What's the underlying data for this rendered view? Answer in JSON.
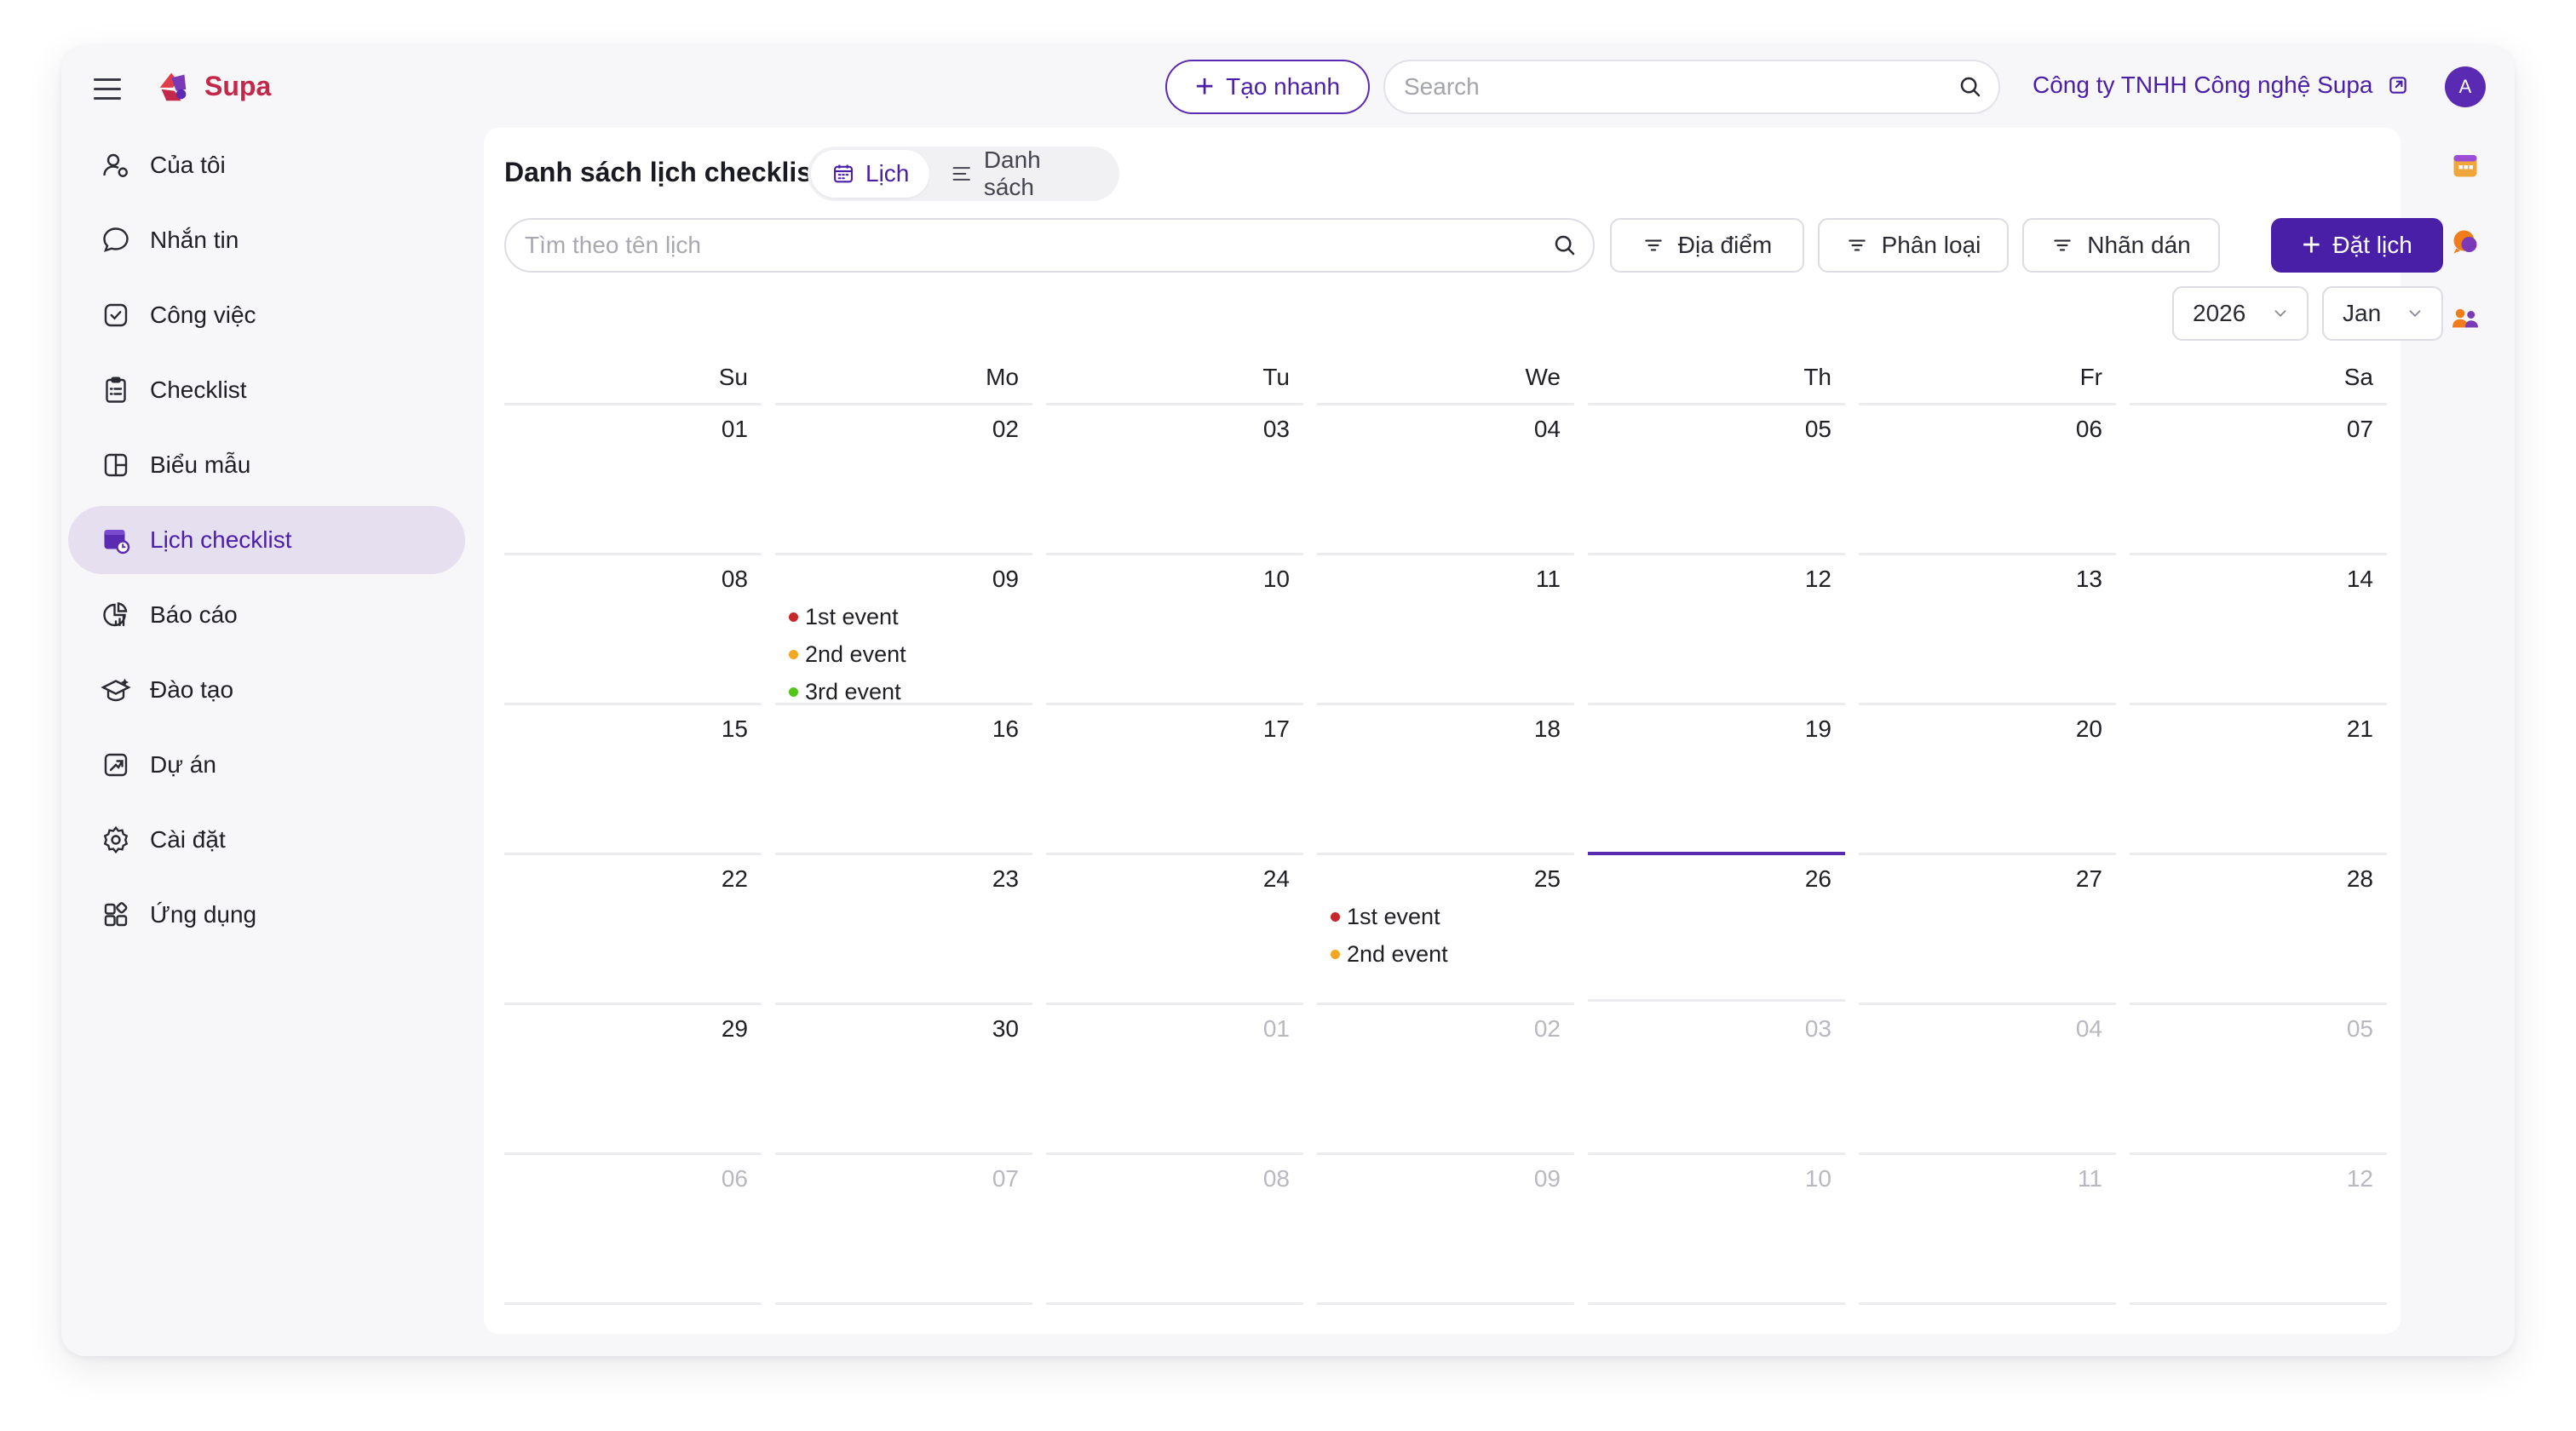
{
  "header": {
    "logo_text": "Supa",
    "quick_create_label": "Tạo nhanh",
    "search_placeholder": "Search",
    "company_name": "Công ty TNHH Công nghệ Supa",
    "avatar_initial": "A"
  },
  "sidebar": {
    "items": [
      {
        "label": "Của tôi",
        "icon": "user-profile-icon"
      },
      {
        "label": "Nhắn tin",
        "icon": "chat-bubble-icon"
      },
      {
        "label": "Công việc",
        "icon": "task-check-icon"
      },
      {
        "label": "Checklist",
        "icon": "clipboard-list-icon"
      },
      {
        "label": "Biểu mẫu",
        "icon": "form-layout-icon"
      },
      {
        "label": "Lịch checklist",
        "icon": "calendar-checklist-icon",
        "active": true
      },
      {
        "label": "Báo cáo",
        "icon": "report-chart-icon"
      },
      {
        "label": "Đào tạo",
        "icon": "graduation-cap-icon"
      },
      {
        "label": "Dự án",
        "icon": "project-icon"
      },
      {
        "label": "Cài đặt",
        "icon": "gear-icon"
      },
      {
        "label": "Ứng dụng",
        "icon": "apps-grid-icon"
      }
    ]
  },
  "main": {
    "title": "Danh sách lịch checklist",
    "view_calendar_label": "Lịch",
    "view_list_label": "Danh sách",
    "search_placeholder": "Tìm theo tên lịch",
    "filter_location": "Địa điểm",
    "filter_category": "Phân loại",
    "filter_tag": "Nhãn dán",
    "book_label": "Đặt lịch",
    "year_value": "2026",
    "month_value": "Jan"
  },
  "calendar": {
    "weekdays": [
      "Su",
      "Mo",
      "Tu",
      "We",
      "Th",
      "Fr",
      "Sa"
    ],
    "days": [
      {
        "num": "01"
      },
      {
        "num": "02"
      },
      {
        "num": "03"
      },
      {
        "num": "04"
      },
      {
        "num": "05"
      },
      {
        "num": "06"
      },
      {
        "num": "07"
      },
      {
        "num": "08"
      },
      {
        "num": "09",
        "events": [
          {
            "label": "1st event",
            "color": "#c62828"
          },
          {
            "label": "2nd event",
            "color": "#f5a623"
          },
          {
            "label": "3rd event",
            "color": "#52c41a"
          }
        ]
      },
      {
        "num": "10"
      },
      {
        "num": "11"
      },
      {
        "num": "12"
      },
      {
        "num": "13"
      },
      {
        "num": "14"
      },
      {
        "num": "15"
      },
      {
        "num": "16"
      },
      {
        "num": "17"
      },
      {
        "num": "18"
      },
      {
        "num": "19"
      },
      {
        "num": "20"
      },
      {
        "num": "21"
      },
      {
        "num": "22"
      },
      {
        "num": "23"
      },
      {
        "num": "24"
      },
      {
        "num": "25",
        "events": [
          {
            "label": "1st event",
            "color": "#c62828"
          },
          {
            "label": "2nd event",
            "color": "#f5a623"
          }
        ]
      },
      {
        "num": "26",
        "today": true
      },
      {
        "num": "27"
      },
      {
        "num": "28"
      },
      {
        "num": "29"
      },
      {
        "num": "30"
      },
      {
        "num": "01",
        "muted": true
      },
      {
        "num": "02",
        "muted": true
      },
      {
        "num": "03",
        "muted": true
      },
      {
        "num": "04",
        "muted": true
      },
      {
        "num": "05",
        "muted": true
      },
      {
        "num": "06",
        "muted": true
      },
      {
        "num": "07",
        "muted": true
      },
      {
        "num": "08",
        "muted": true
      },
      {
        "num": "09",
        "muted": true
      },
      {
        "num": "10",
        "muted": true
      },
      {
        "num": "11",
        "muted": true
      },
      {
        "num": "12",
        "muted": true
      }
    ]
  },
  "colors": {
    "accent": "#4a1fa8",
    "brand": "#c3284a",
    "active_nav_bg": "#e5dff0"
  }
}
